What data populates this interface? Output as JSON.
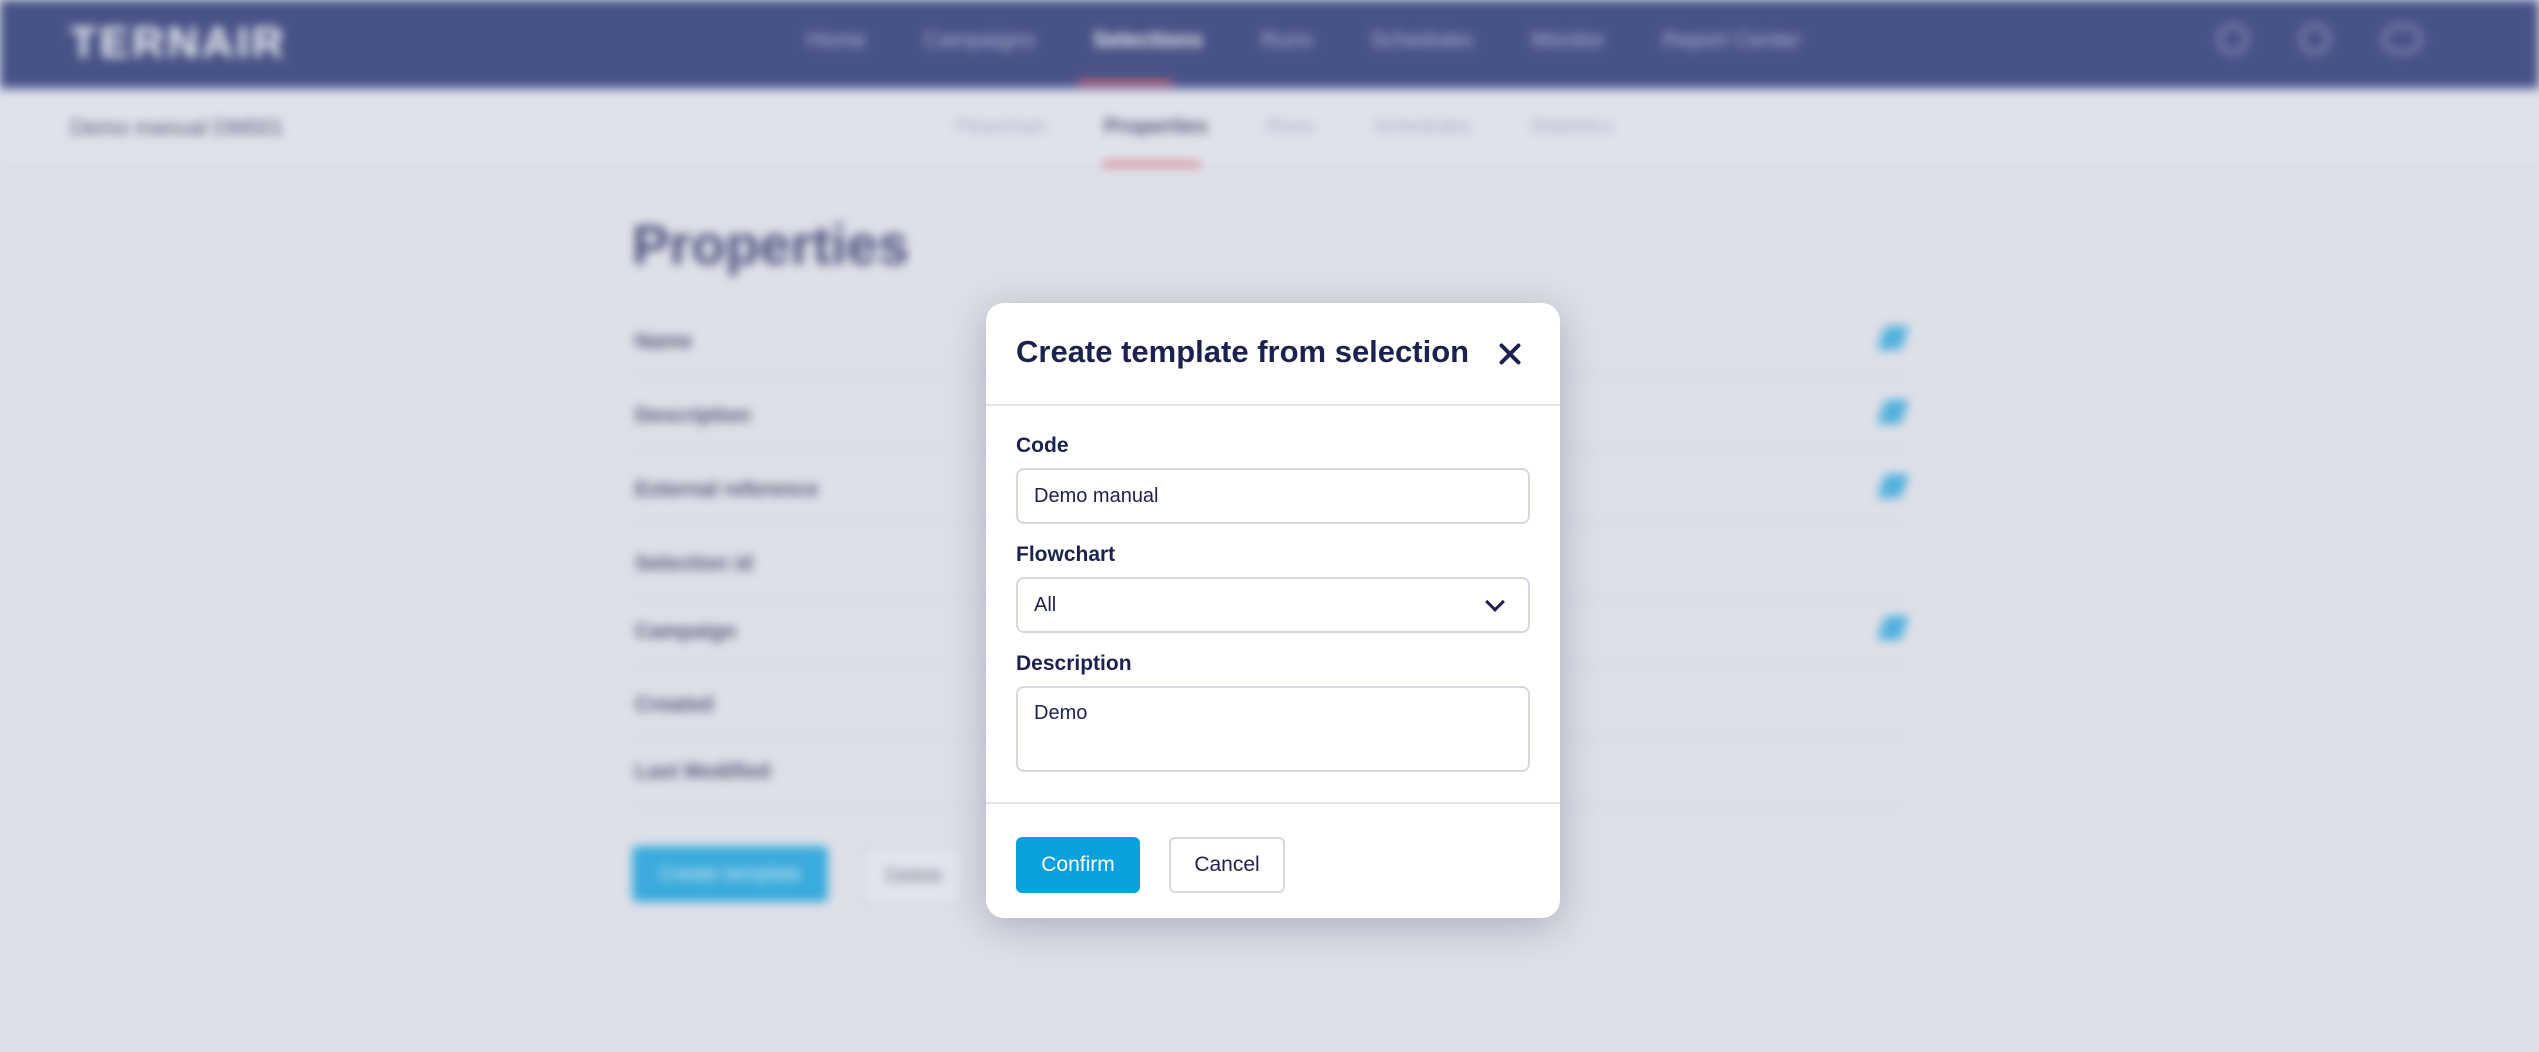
{
  "topbar": {
    "logo": "TERNAIR",
    "nav": [
      "Home",
      "Campaigns",
      "Selections",
      "Runs",
      "Schedules",
      "Monitor",
      "Report Center"
    ],
    "active_nav": "Selections",
    "user_caret": "⌄"
  },
  "subbar": {
    "title": "Demo manual DM001",
    "tabs": [
      "Flowchart",
      "Properties",
      "Runs",
      "Schedules",
      "Statistics"
    ],
    "active_tab": "Properties"
  },
  "properties": {
    "title": "Properties",
    "rows": [
      "Name",
      "Description",
      "External reference",
      "Selection id",
      "Campaign",
      "Created",
      "Last Modified"
    ],
    "create_template_label": "Create template",
    "delete_label": "Delete"
  },
  "modal": {
    "title": "Create template from selection",
    "code_label": "Code",
    "code_value": "Demo manual",
    "flowchart_label": "Flowchart",
    "flowchart_value": "All",
    "description_label": "Description",
    "description_value": "Demo",
    "confirm_label": "Confirm",
    "cancel_label": "Cancel"
  },
  "colors": {
    "primary": "#0aa0de",
    "navbar": "#1d2a6b",
    "accent_underline": "#e0404a",
    "heading": "#1c2250"
  }
}
